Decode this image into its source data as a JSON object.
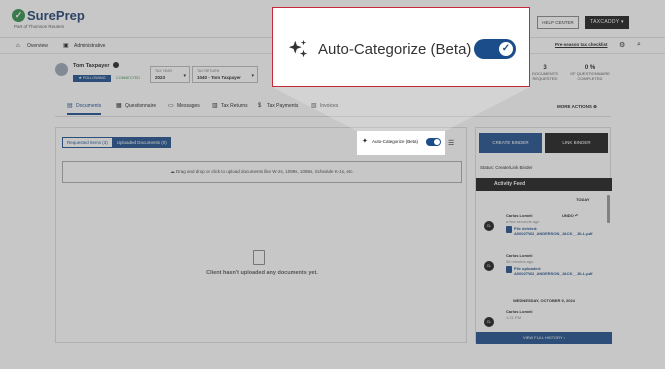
{
  "app": {
    "logo_text": "SurePrep",
    "logo_sub": "Part of Thomson Reuters",
    "help_center": "HELP CENTER",
    "taxcaddy": "TAXCADDY ▾"
  },
  "nav": {
    "overview": "Overview",
    "administrative": "Administrative",
    "checklist": "Pre-season tax checklist"
  },
  "client": {
    "name": "Tom Taxpayer",
    "following": "★ FOLLOWING",
    "connected": "CONNECTED",
    "tax_year_label": "TAX YEAR",
    "tax_year": "2023",
    "tax_return_label": "TAX RETURN",
    "tax_return": "1040 - Tom Taxpayer",
    "stat1_value": "3",
    "stat1_label": "DOCUMENTS REQUESTED",
    "stat2_value": "0 %",
    "stat2_label": "OF QUESTIONNAIRE COMPLETED"
  },
  "tabs": [
    {
      "label": "Documents",
      "icon": "documents-icon"
    },
    {
      "label": "Questionnaire",
      "icon": "questionnaire-icon"
    },
    {
      "label": "Messages",
      "icon": "messages-icon"
    },
    {
      "label": "Tax Returns",
      "icon": "tax-returns-icon"
    },
    {
      "label": "Tax Payments",
      "icon": "tax-payments-icon"
    },
    {
      "label": "Invoices",
      "icon": "invoices-icon"
    }
  ],
  "more_actions": "MORE ACTIONS ⊕",
  "documents": {
    "requested_tab": "Requested Items (3)",
    "uploaded_tab": "Uploaded Documents (0)",
    "dropzone": "Drag and drop or click to upload documents like W-2s, 1099s, 1098s, Schedule K-1s, etc.",
    "empty": "Client hasn't uploaded any documents yet."
  },
  "auto_categorize": {
    "label": "Auto-Categorize (Beta)",
    "enabled": true
  },
  "binder": {
    "create": "CREATE BINDER",
    "link": "LINK BINDER",
    "status": "Status: Create/Link Binder"
  },
  "activity": {
    "title": "Activity Feed",
    "today": "TODAY",
    "undo": "UNDO ↶",
    "items": [
      {
        "initials": "CL",
        "name": "Carlos Lomeli",
        "time": "a few seconds ago",
        "file": "File deleted: A0002TW2_ANDERSON_JACK__JILL.pdf"
      },
      {
        "initials": "CL",
        "name": "Carlos Lomeli",
        "time": "56 minutes ago",
        "file": "File uploaded: A0002TW2_ANDERSON_JACK__JILL.pdf"
      },
      {
        "initials": "CL",
        "name": "Carlos Lomeli",
        "time": "1:21 PM",
        "file": ""
      }
    ],
    "date_separator": "WEDNESDAY, OCTOBER 9, 2024",
    "view_history": "VIEW FULL HISTORY"
  },
  "colors": {
    "brand_blue": "#1c4d8b",
    "callout_border": "#c8283a",
    "dark": "#1b1b1b"
  }
}
